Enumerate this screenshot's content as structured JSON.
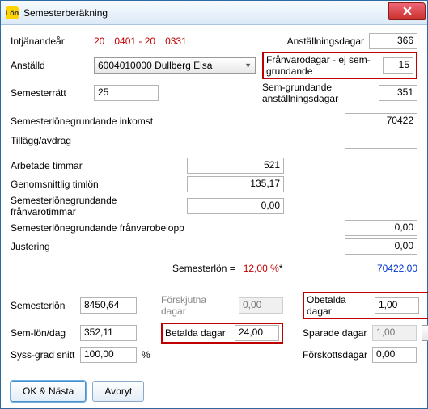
{
  "window": {
    "title": "Semesterberäkning",
    "icon_text": "Lön"
  },
  "top": {
    "intjanandear_label": "Intjänandeår",
    "intjanandear_prefix1": "20",
    "intjanandear_md1": "0401",
    "intjanandear_dash": " - 20",
    "intjanandear_md2": "0331",
    "anstallningsdagar_label": "Anställningsdagar",
    "anstallningsdagar_value": "366",
    "anstalld_label": "Anställd",
    "anstalld_value": "6004010000  Dullberg Elsa",
    "franvarodagar_label": "Frånvarodagar - ej sem-grundande",
    "franvarodagar_value": "15",
    "semesterratt_label": "Semesterrätt",
    "semesterratt_value": "25",
    "semgrund_label": "Sem-grundande anställningsdagar",
    "semgrund_value": "351"
  },
  "inkomst": {
    "label": "Semesterlönegrundande inkomst",
    "value": "70422",
    "tillagg_label": "Tillägg/avdrag",
    "tillagg_value": ""
  },
  "mid": {
    "arbetade_timmar_label": "Arbetade timmar",
    "arbetade_timmar_value": "521",
    "genomsnittlig_timlon_label": "Genomsnittlig timlön",
    "genomsnittlig_timlon_value": "135,17",
    "sfg_timmar_label": "Semesterlönegrundande frånvarotimmar",
    "sfg_timmar_value": "0,00",
    "sfg_belopp_label": "Semesterlönegrundande frånvarobelopp",
    "sfg_belopp_value": "0,00",
    "justering_label": "Justering",
    "justering_value": "0,00",
    "semesterlon_eq": "Semesterlön  =",
    "semesterlon_pct": "12,00 %",
    "semesterlon_star": " *",
    "semesterlon_total": "70422,00"
  },
  "bottom": {
    "semesterlon_label": "Semesterlön",
    "semesterlon_value": "8450,64",
    "forskjutna_label": "Förskjutna dagar",
    "forskjutna_value": "0,00",
    "obetalda_label": "Obetalda dagar",
    "obetalda_value": "1,00",
    "semlon_dag_label": "Sem-lön/dag",
    "semlon_dag_value": "352,11",
    "betalda_label": "Betalda dagar",
    "betalda_value": "24,00",
    "sparade_label": "Sparade dagar",
    "sparade_value": "1,00",
    "syss_label": "Syss-grad snitt",
    "syss_value": "100,00",
    "syss_pct": "%",
    "forskottsdagar_label": "Förskottsdagar",
    "forskottsdagar_value": "0,00"
  },
  "buttons": {
    "ok": "OK & Nästa",
    "cancel": "Avbryt"
  },
  "icons": {
    "close": "x",
    "browse": "..."
  }
}
